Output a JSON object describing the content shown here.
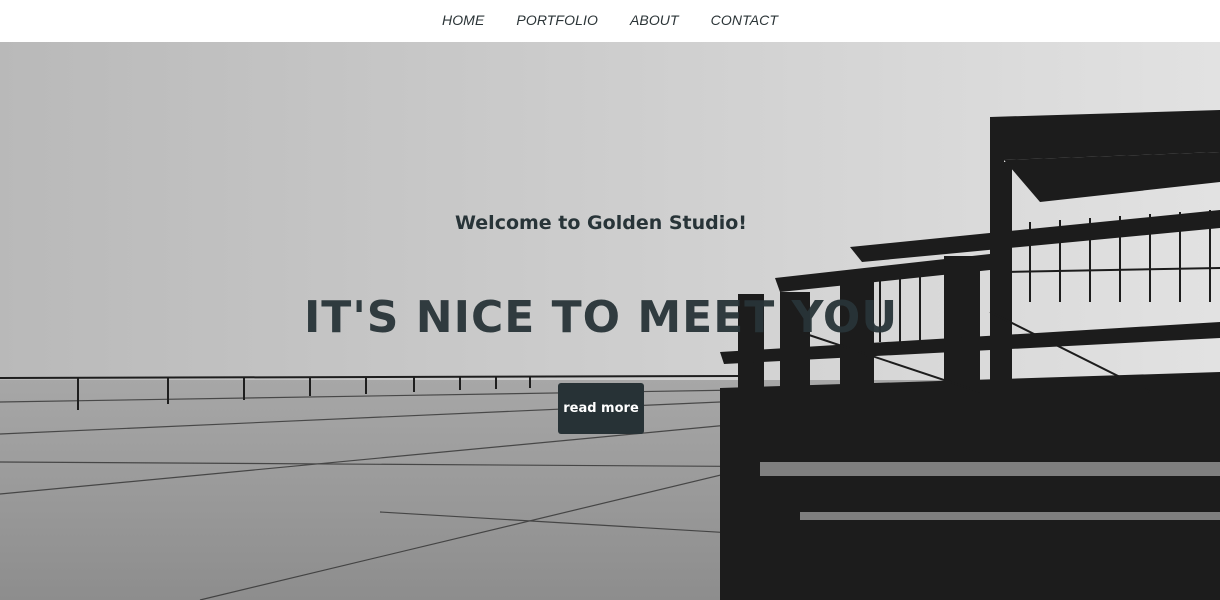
{
  "nav": {
    "items": [
      {
        "label": "HOME"
      },
      {
        "label": "PORTFOLIO"
      },
      {
        "label": "ABOUT"
      },
      {
        "label": "CONTACT"
      }
    ]
  },
  "hero": {
    "welcome": "Welcome to Golden Studio!",
    "headline": "IT'S NICE TO MEET YOU",
    "button_label": "read more",
    "background": "grayscale photo of a modern building with reflective rooftop"
  },
  "colors": {
    "text_dark": "#283438",
    "button_bg": "#273236",
    "nav_bg": "#ffffff"
  }
}
